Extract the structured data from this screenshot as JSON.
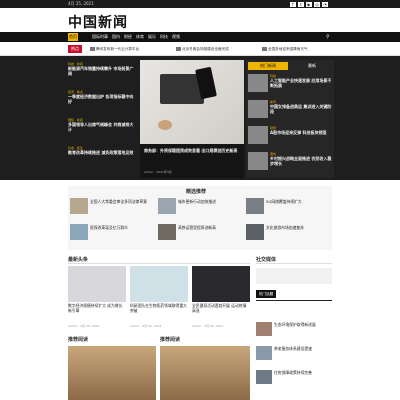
{
  "topbar": {
    "date": "4月 25, 2021"
  },
  "site": {
    "logo": "中国新闻"
  },
  "nav": {
    "items": [
      "首页",
      "国际时事",
      "国内",
      "财经",
      "体育",
      "娱乐",
      "科技",
      "视频"
    ]
  },
  "ticker": {
    "tag": "热点",
    "items": [
      "腾讯发布新一代云计算平台",
      "北京冬奥会场馆建设全面完成",
      "全国多地迎来强降雨天气"
    ]
  },
  "hero": {
    "left": [
      {
        "tag": "科技 · 新闻",
        "title": "新能源汽车销量持续攀升 市场前景广阔"
      },
      {
        "tag": "经济 · 焦点",
        "title": "一季度经济数据出炉 各项指标稳中向好"
      },
      {
        "tag": "国际 · 新闻",
        "title": "多国领导人出席气候峰会 共商减排大计"
      },
      {
        "tag": "社会 · 民生",
        "title": "教育改革持续推进 减负政策落地见效"
      }
    ],
    "main": {
      "title": "商务部：外贸保稳提质成效显著 出口规模创历史新高",
      "meta": "admin · 2021年4月"
    },
    "sidebar": {
      "tabs": [
        "热门新闻",
        "最新"
      ],
      "items": [
        {
          "tag": "科技",
          "title": "人工智能产业快速发展 应用场景不断拓展"
        },
        {
          "tag": "体育",
          "title": "中国女排备战奥运 集训进入关键阶段"
        },
        {
          "tag": "财经",
          "title": "A股市场迎来反弹 科技板块领涨"
        },
        {
          "tag": "国内",
          "title": "乡村振兴战略全面推进 农民收入稳步增长"
        }
      ]
    }
  },
  "featured": {
    "heading": "精选推荐",
    "items": [
      "全国人大常委会审议多项法律草案",
      "城市更新行动加快推进",
      "5G网络覆盖持续扩大",
      "医保改革惠及亿万群众",
      "高铁运营里程再创新高",
      "文化旅游市场加速复苏"
    ]
  },
  "section2": {
    "heading": "最新头条",
    "cards": [
      {
        "title": "数字经济规模持续扩大 成为增长新引擎",
        "meta": "admin · 4月 25, 2021"
      },
      {
        "title": "科研团队在生物医药领域取得重大突破",
        "meta": "admin · 4月 25, 2021"
      },
      {
        "title": "全民健身活动蓬勃开展 运动热情高涨",
        "meta": "admin · 4月 25, 2021"
      }
    ]
  },
  "sidebar2": {
    "heading": "社交媒体",
    "sub": "热门话题",
    "items": [
      "生态环境保护取得新进展",
      "养老服务体系建设提速",
      "住房保障政策持续完善"
    ]
  },
  "section3": {
    "headings": [
      "推荐阅读",
      "推荐阅读"
    ]
  }
}
